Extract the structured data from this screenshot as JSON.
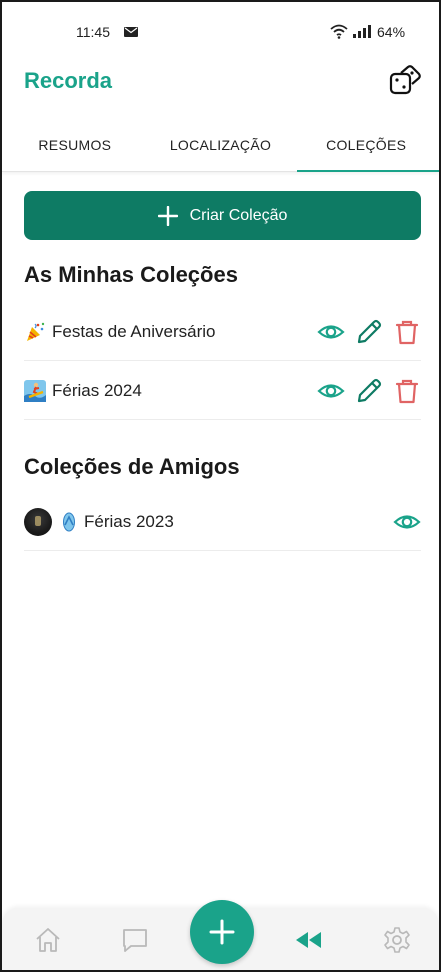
{
  "status": {
    "time": "11:45",
    "battery": "64%"
  },
  "app": {
    "title": "Recorda"
  },
  "tabs": [
    {
      "label": "RESUMOS",
      "active": false
    },
    {
      "label": "LOCALIZAÇÃO",
      "active": false
    },
    {
      "label": "COLEÇÕES",
      "active": true
    }
  ],
  "create_button": {
    "label": "Criar Coleção"
  },
  "my_collections": {
    "title": "As Minhas Coleções",
    "items": [
      {
        "emoji_icon": "party-popper-icon",
        "label": "Festas de Aniversário"
      },
      {
        "emoji_icon": "surfer-icon",
        "label": "Férias 2024"
      }
    ]
  },
  "friends_collections": {
    "title": "Coleções de Amigos",
    "items": [
      {
        "emoji_icon": "flip-flop-icon",
        "label": "Férias 2023"
      }
    ]
  },
  "colors": {
    "accent": "#1aa38a",
    "button": "#0e7b64",
    "delete": "#e06464"
  },
  "bottom_nav": [
    "home-icon",
    "chat-icon",
    "add-icon",
    "rewind-icon",
    "settings-icon"
  ]
}
